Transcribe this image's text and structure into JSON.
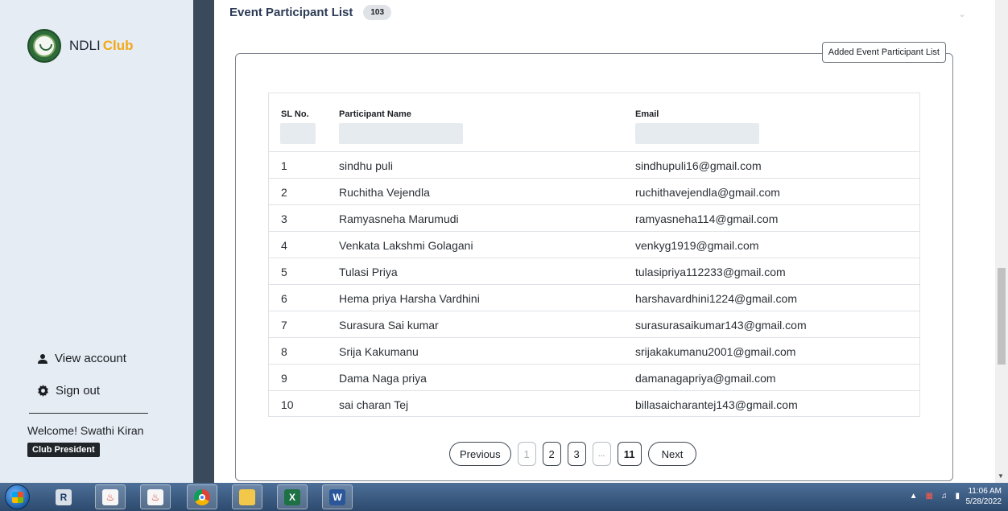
{
  "sidebar": {
    "brand": "NDLI",
    "brand_accent": "Club",
    "view_account": "View account",
    "sign_out": "Sign out",
    "welcome": "Welcome! Swathi Kiran",
    "role": "Club President"
  },
  "header": {
    "title": "Event Participant List",
    "count": "103"
  },
  "panel": {
    "legend": "Added Event Participant List"
  },
  "table": {
    "headers": [
      "SL No.",
      "Participant Name",
      "Email"
    ],
    "rows": [
      {
        "sl": "1",
        "name": "sindhu puli",
        "email": "sindhupuli16@gmail.com"
      },
      {
        "sl": "2",
        "name": "Ruchitha Vejendla",
        "email": "ruchithavejendla@gmail.com"
      },
      {
        "sl": "3",
        "name": "Ramyasneha Marumudi",
        "email": "ramyasneha114@gmail.com"
      },
      {
        "sl": "4",
        "name": "Venkata Lakshmi Golagani",
        "email": "venkyg1919@gmail.com"
      },
      {
        "sl": "5",
        "name": "Tulasi Priya",
        "email": "tulasipriya112233@gmail.com"
      },
      {
        "sl": "6",
        "name": "Hema priya Harsha Vardhini",
        "email": "harshavardhini1224@gmail.com"
      },
      {
        "sl": "7",
        "name": "Surasura Sai kumar",
        "email": "surasurasaikumar143@gmail.com"
      },
      {
        "sl": "8",
        "name": "Srija Kakumanu",
        "email": "srijakakumanu2001@gmail.com"
      },
      {
        "sl": "9",
        "name": "Dama Naga priya",
        "email": "damanagapriya@gmail.com"
      },
      {
        "sl": "10",
        "name": "sai charan Tej",
        "email": "billasaicharantej143@gmail.com"
      }
    ]
  },
  "pagination": {
    "previous": "Previous",
    "pages": [
      "1",
      "2",
      "3",
      "...",
      "11"
    ],
    "next": "Next"
  },
  "taskbar": {
    "time": "11:06 AM",
    "date": "5/28/2022"
  },
  "colors": {
    "sidebar_bg": "#e6ecf3",
    "accent": "#f2a818",
    "title": "#2b3a55"
  }
}
